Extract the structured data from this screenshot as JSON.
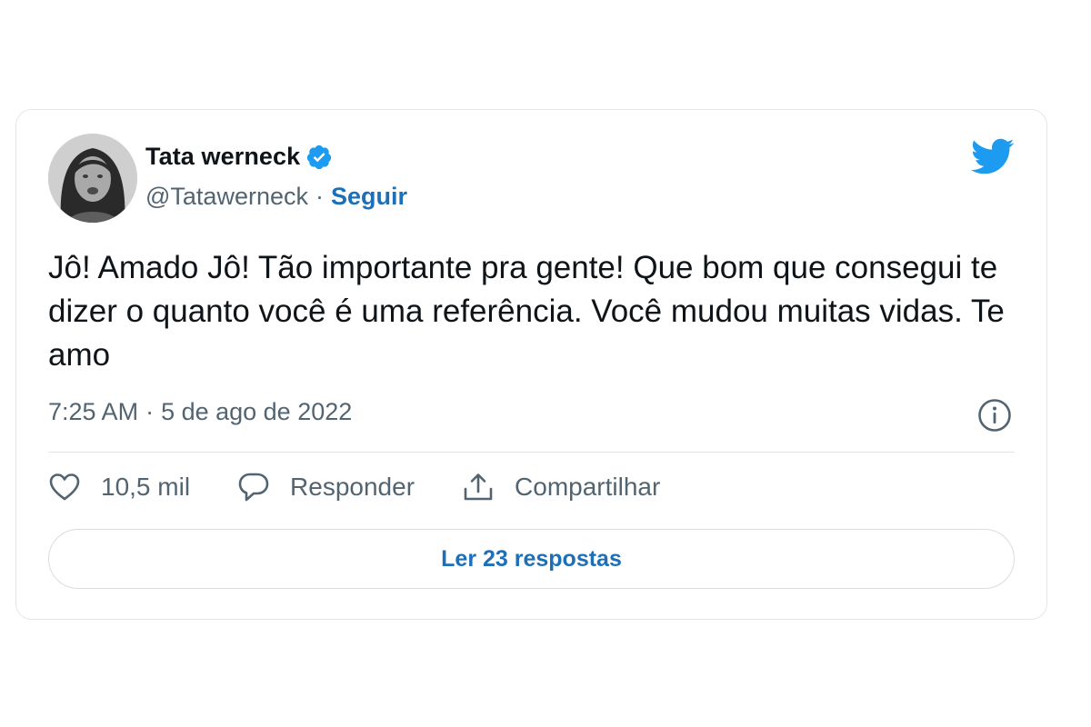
{
  "tweet": {
    "author_name": "Tata werneck",
    "handle": "@Tatawerneck",
    "handle_separator": "·",
    "follow_label": "Seguir",
    "text": "Jô! Amado Jô! Tão importante pra gente! Que bom que consegui te dizer o quanto você é uma referência. Você mudou muitas vidas. Te amo",
    "time": "7:25 AM",
    "date_separator": "·",
    "date": "5 de ago de 2022"
  },
  "actions": {
    "likes_count": "10,5 mil",
    "reply_label": "Responder",
    "share_label": "Compartilhar"
  },
  "replies_button_label": "Ler 23 respostas",
  "icons": {
    "verified": "verified-badge-icon",
    "brand": "twitter-bird-icon",
    "info": "info-icon",
    "like": "heart-icon",
    "reply": "speech-bubble-icon",
    "share": "share-upload-icon"
  },
  "colors": {
    "brand_blue": "#1d9bf0",
    "link_blue": "#1d6fb8",
    "secondary_text": "#536471",
    "primary_text": "#0f1419"
  }
}
